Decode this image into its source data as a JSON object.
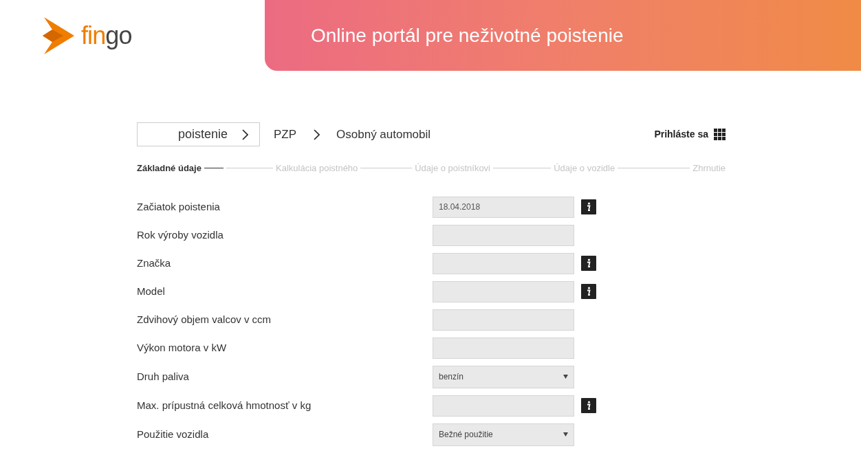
{
  "logo": {
    "text": "fingo"
  },
  "banner": {
    "title": "Online portál pre neživotné poistenie"
  },
  "breadcrumb": [
    {
      "label": "poistenie",
      "kind": "box"
    },
    {
      "label": "PZP",
      "kind": "plain"
    },
    {
      "label": "Osobný automobil",
      "kind": "plain"
    }
  ],
  "login": {
    "label": "Prihláste sa"
  },
  "steps": [
    {
      "label": "Základné údaje",
      "selected": true
    },
    {
      "label": "Kalkulácia poistného",
      "selected": false
    },
    {
      "label": "Údaje o poistníkovi",
      "selected": false
    },
    {
      "label": "Údaje o vozidle",
      "selected": false
    },
    {
      "label": "Zhrnutie",
      "selected": false
    }
  ],
  "fields": [
    {
      "label": "Začiatok poistenia",
      "kind": "input",
      "value": "18.04.2018",
      "info": true
    },
    {
      "label": "Rok výroby vozidla",
      "kind": "input",
      "info": false
    },
    {
      "label": "Značka",
      "kind": "input",
      "info": true
    },
    {
      "label": "Model",
      "kind": "input",
      "info": true
    },
    {
      "label": "Zdvihový objem valcov v ccm",
      "kind": "input",
      "info": false
    },
    {
      "label": "Výkon motora v kW",
      "kind": "input",
      "info": false
    },
    {
      "label": "Druh paliva",
      "kind": "select",
      "value": "benzín",
      "info": false
    },
    {
      "label": "Max. prípustná celková hmotnosť v kg",
      "kind": "input",
      "info": true
    },
    {
      "label": "Použitie vozidla",
      "kind": "select",
      "value": "Bežné použitie",
      "info": false
    }
  ]
}
